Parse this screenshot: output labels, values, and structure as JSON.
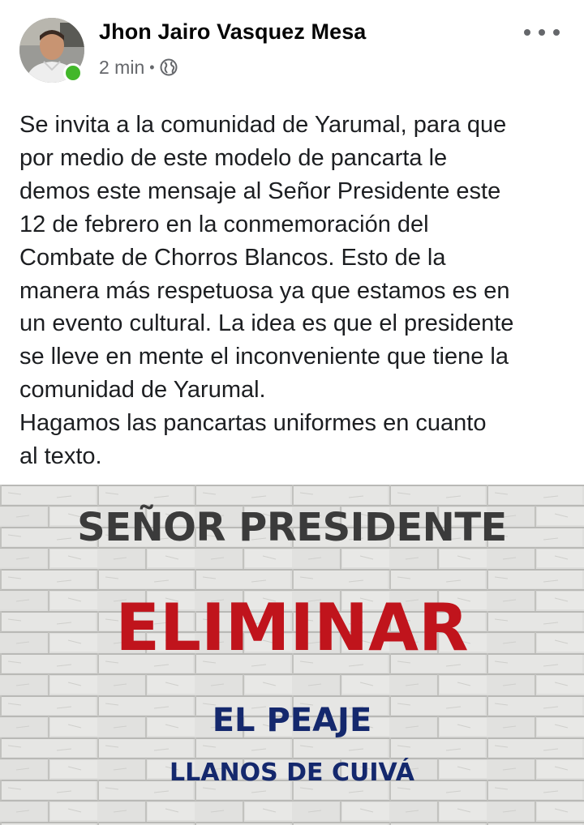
{
  "post": {
    "author": "Jhon Jairo Vasquez Mesa",
    "time": "2 min",
    "separator": "•",
    "privacy_icon": "globe-icon",
    "more_icon": "more-horizontal-icon",
    "online_status_color": "#42b72a",
    "text_lines": [
      "Se invita a la comunidad de Yarumal, para que",
      "por medio de este modelo de pancarta le",
      "demos este mensaje al Señor Presidente este",
      "12 de febrero en la conmemoración del",
      "Combate de Chorros Blancos. Esto de la",
      "manera más respetuosa ya que estamos es en",
      "un evento cultural. La idea es que el presidente",
      "se lleve en mente el inconveniente que tiene la",
      "comunidad de Yarumal.",
      "Hagamos las pancartas uniformes en cuanto",
      "al texto."
    ]
  },
  "banner": {
    "line1": "SEÑOR PRESIDENTE",
    "line2": "ELIMINAR",
    "line3": "EL PEAJE",
    "line4": "LLANOS DE CUIVÁ",
    "colors": {
      "line1": "#3b3b3b",
      "line2": "#c0141c",
      "line3": "#14286d",
      "line4": "#14286d",
      "wall": "#d9d9d7"
    }
  }
}
